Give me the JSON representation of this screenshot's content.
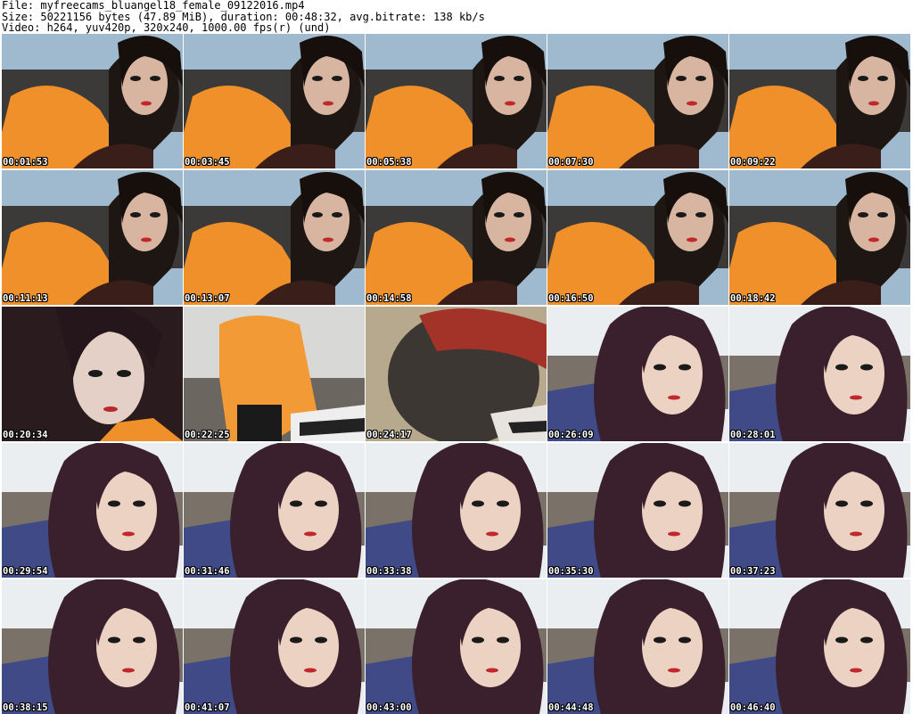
{
  "header": {
    "file_line": "File: myfreecams_bluangel18_female_09122016.mp4",
    "size_line": "Size: 50221156 bytes (47.89 MiB), duration: 00:48:32, avg.bitrate: 138 kb/s",
    "video_line": "Video: h264, yuv420p, 320x240, 1000.00 fps(r) (und)"
  },
  "thumbnails": [
    {
      "timestamp": "00:01:53",
      "scene": "orange"
    },
    {
      "timestamp": "00:03:45",
      "scene": "orange"
    },
    {
      "timestamp": "00:05:38",
      "scene": "orange"
    },
    {
      "timestamp": "00:07:30",
      "scene": "orange"
    },
    {
      "timestamp": "00:09:22",
      "scene": "orange"
    },
    {
      "timestamp": "00:11:13",
      "scene": "orange"
    },
    {
      "timestamp": "00:13:07",
      "scene": "orange"
    },
    {
      "timestamp": "00:14:58",
      "scene": "orange"
    },
    {
      "timestamp": "00:16:50",
      "scene": "orange"
    },
    {
      "timestamp": "00:18:42",
      "scene": "orange"
    },
    {
      "timestamp": "00:20:34",
      "scene": "orange-close"
    },
    {
      "timestamp": "00:22:25",
      "scene": "room"
    },
    {
      "timestamp": "00:24:17",
      "scene": "dark-close"
    },
    {
      "timestamp": "00:26:09",
      "scene": "purple"
    },
    {
      "timestamp": "00:28:01",
      "scene": "purple"
    },
    {
      "timestamp": "00:29:54",
      "scene": "purple"
    },
    {
      "timestamp": "00:31:46",
      "scene": "purple"
    },
    {
      "timestamp": "00:33:38",
      "scene": "purple"
    },
    {
      "timestamp": "00:35:30",
      "scene": "purple"
    },
    {
      "timestamp": "00:37:23",
      "scene": "purple"
    },
    {
      "timestamp": "00:38:15",
      "scene": "purple"
    },
    {
      "timestamp": "00:41:07",
      "scene": "purple"
    },
    {
      "timestamp": "00:43:00",
      "scene": "purple"
    },
    {
      "timestamp": "00:44:48",
      "scene": "purple"
    },
    {
      "timestamp": "00:46:40",
      "scene": "purple"
    }
  ],
  "colors": {
    "background": "#ffffff",
    "timestamp_text": "#ffffff",
    "timestamp_outline": "#000000"
  }
}
